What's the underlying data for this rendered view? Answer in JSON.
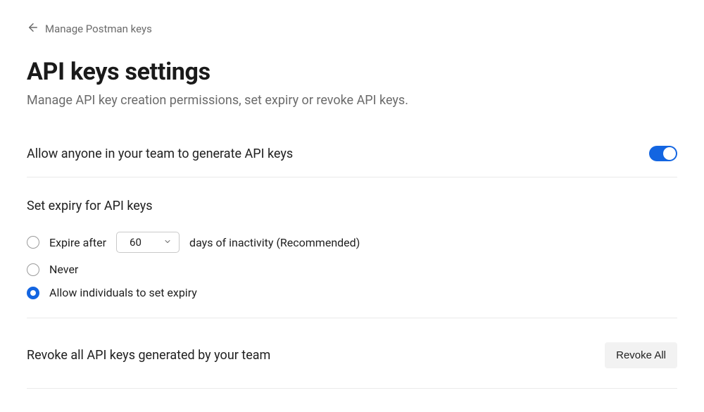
{
  "breadcrumb": {
    "label": "Manage Postman keys"
  },
  "page": {
    "title": "API keys settings",
    "subtitle": "Manage API key creation permissions, set expiry or revoke API keys."
  },
  "generate_section": {
    "label": "Allow anyone in your team to generate API keys",
    "toggle_on": true
  },
  "expiry_section": {
    "heading": "Set expiry for API keys",
    "options": [
      {
        "prefix": "Expire after",
        "select_value": "60",
        "suffix": "days of inactivity (Recommended)",
        "selected": false,
        "has_select": true
      },
      {
        "label": "Never",
        "selected": false
      },
      {
        "label": "Allow individuals to set expiry",
        "selected": true
      }
    ]
  },
  "revoke_section": {
    "label": "Revoke all API keys generated by your team",
    "button_label": "Revoke All"
  }
}
